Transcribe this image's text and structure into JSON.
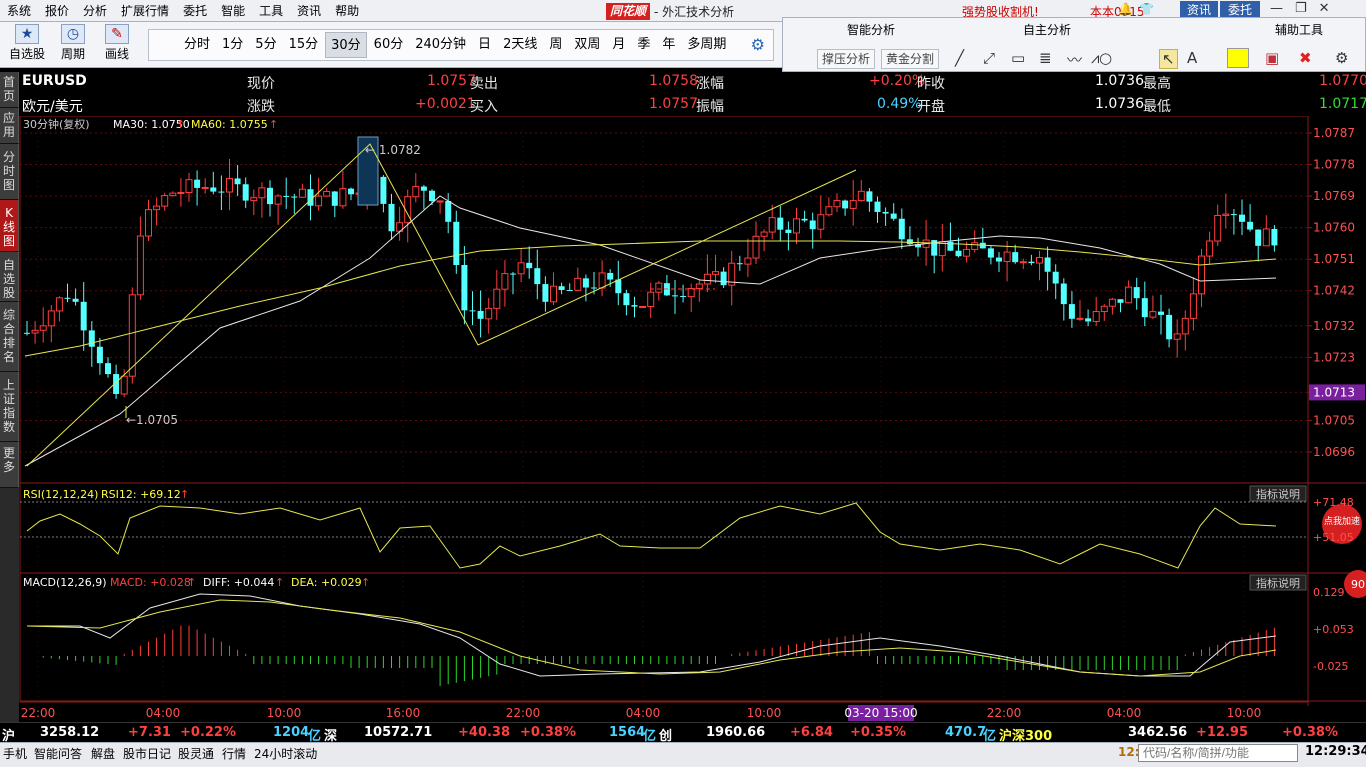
{
  "menu": [
    "系统",
    "报价",
    "分析",
    "扩展行情",
    "委托",
    "智能",
    "工具",
    "资讯",
    "帮助"
  ],
  "brand": {
    "logo": "同花顺",
    "sub": "- 外汇技术分析"
  },
  "promo": "强势股收割机!",
  "user": "本本0915",
  "top_buttons": {
    "zixun": "资讯",
    "weituo": "委托"
  },
  "toolbar": {
    "zixuangu": "自选股",
    "zhouqi": "周期",
    "huaxian": "画线",
    "periods": [
      "分时",
      "1分",
      "5分",
      "15分",
      "30分",
      "60分",
      "240分钟",
      "日",
      "2天线",
      "周",
      "双周",
      "月",
      "季",
      "年",
      "多周期"
    ],
    "selected_period": "30分"
  },
  "right_tools": {
    "zhineng": "智能分析",
    "zizhu": "自主分析",
    "fuzhu": "辅助工具",
    "yacheng": "撑压分析",
    "huangjin": "黄金分割"
  },
  "left_nav": [
    {
      "label": "首页"
    },
    {
      "label": "应用"
    },
    {
      "label": "分时图"
    },
    {
      "label": "K线图",
      "selected": true
    },
    {
      "label": "自选股"
    },
    {
      "label": "综合排名"
    },
    {
      "label": "上证指数"
    },
    {
      "label": "更多"
    }
  ],
  "quote": {
    "code": "EURUSD",
    "name": "欧元/美元",
    "xianjia_l": "现价",
    "xianjia": "1.0757",
    "maichu_l": "卖出",
    "maichu": "1.0758",
    "zhangfu_l": "涨幅",
    "zhangfu": "+0.20%",
    "zuoshou_l": "昨收",
    "zuoshou": "1.0736",
    "zuigao_l": "最高",
    "zuigao": "1.0770",
    "zhangdie_l": "涨跌",
    "zhangdie": "+0.0021",
    "mairu_l": "买入",
    "mairu": "1.0757",
    "zhenfu_l": "振幅",
    "zhenfu": "0.49%",
    "kaipan_l": "开盘",
    "kaipan": "1.0736",
    "zuidi_l": "最低",
    "zuidi": "1.0717"
  },
  "chart_data": {
    "type": "candlestick",
    "main": {
      "legend_period": "30分钟(复权)",
      "ma30_label": "MA30: 1.0750",
      "ma60_label": "MA60: 1.0755",
      "y_ticks": [
        "1.0787",
        "1.0778",
        "1.0769",
        "1.0760",
        "1.0751",
        "1.0742",
        "1.0732",
        "1.0723",
        "1.0713",
        "1.0705",
        "1.0696"
      ],
      "current_price_tag": "1.0713",
      "high_mark": "1.0782",
      "low_mark": "1.0705"
    },
    "rsi": {
      "label": "RSI(12,12,24)",
      "value_label": "RSI12: +69.12",
      "ticks": [
        "71.48",
        "51.05"
      ],
      "explain": "指标说明"
    },
    "macd": {
      "label": "MACD(12,26,9)",
      "macd_label": "MACD: +0.028",
      "diff_label": "DIFF: +0.044",
      "dea_label": "DEA: +0.029",
      "ticks": [
        "0.129",
        "+0.053",
        "-0.025"
      ],
      "explain": "指标说明"
    },
    "x_ticks": [
      "22:00",
      "04:00",
      "10:00",
      "16:00",
      "22:00",
      "04:00",
      "10:00",
      "03-20 15:00",
      "22:00",
      "04:00",
      "10:00"
    ],
    "badge": "点我加速",
    "badge_num": "90"
  },
  "status": {
    "hu": "沪",
    "hu_val": "3258.12",
    "hu_chg": "+7.31",
    "hu_pct": "+0.22%",
    "amt1": "1204",
    "amt1_u": "亿",
    "shen": "深",
    "shen_val": "10572.71",
    "shen_chg": "+40.38",
    "shen_pct": "+0.38%",
    "amt2": "1564",
    "amt2_u": "亿",
    "chuang": "创",
    "chuang_val": "1960.66",
    "chuang_chg": "+6.84",
    "chuang_pct": "+0.35%",
    "amt3": "470.7",
    "amt3_u": "亿",
    "hs300": "沪深300",
    "hs_val": "3462.56",
    "hs_chg": "+12.95",
    "hs_pct": "+0.38%"
  },
  "taskbar": {
    "items": [
      "手机",
      "智能问答",
      "解盘",
      "股市日记",
      "股灵通",
      "行情",
      "24小时滚动"
    ],
    "code_hint": "代码/名称/简拼/功能",
    "clock": "12:29:34",
    "clock_short": "12:"
  }
}
